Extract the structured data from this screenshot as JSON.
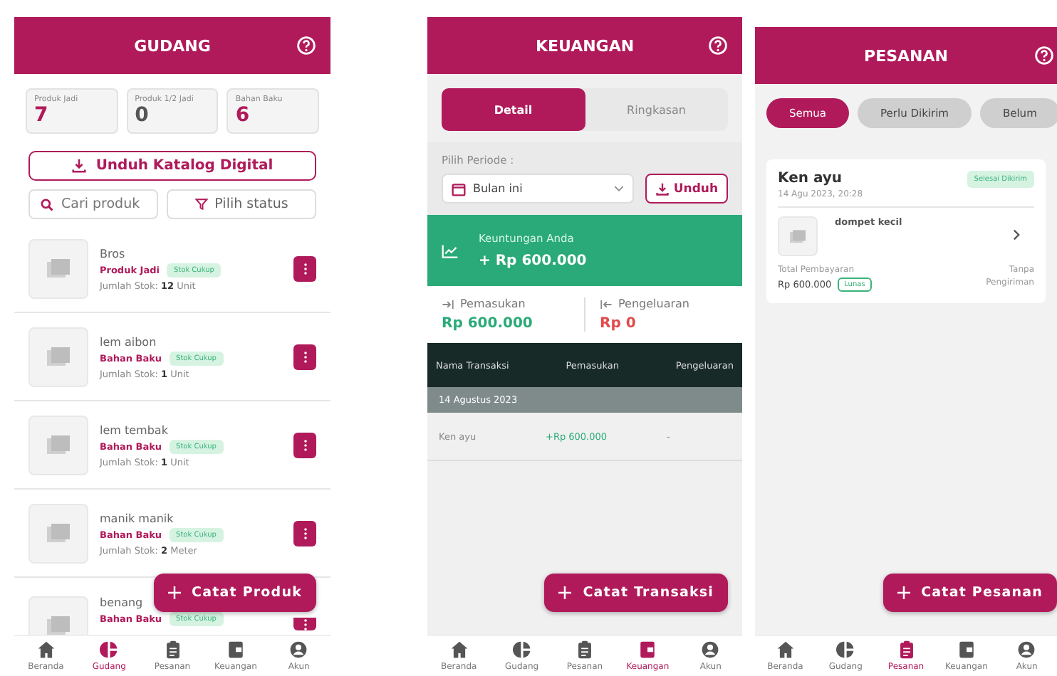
{
  "screens": [
    {
      "kind": "gudang",
      "title": "GUDANG",
      "stats": [
        {
          "label": "Produk Jadi",
          "value": "7",
          "color": "#b01a5a"
        },
        {
          "label": "Produk 1/2 Jadi",
          "value": "0",
          "color": "#555555"
        },
        {
          "label": "Bahan Baku",
          "value": "6",
          "color": "#b01a5a"
        }
      ],
      "catalog_button": "Unduh Katalog Digital",
      "search": {
        "placeholder": "Cari produk"
      },
      "filter_button": "Pilih status",
      "products": [
        {
          "name": "Bros",
          "category": "Produk Jadi",
          "badge": "Stok Cukup",
          "stock_label": "Jumlah Stok:",
          "qty": "12",
          "unit": "Unit"
        },
        {
          "name": "lem aibon",
          "category": "Bahan Baku",
          "badge": "Stok Cukup",
          "stock_label": "Jumlah Stok:",
          "qty": "1",
          "unit": "Unit"
        },
        {
          "name": "lem tembak",
          "category": "Bahan Baku",
          "badge": "Stok Cukup",
          "stock_label": "Jumlah Stok:",
          "qty": "1",
          "unit": "Unit"
        },
        {
          "name": "manik manik",
          "category": "Bahan Baku",
          "badge": "Stok Cukup",
          "stock_label": "Jumlah Stok:",
          "qty": "2",
          "unit": "Meter"
        },
        {
          "name": "benang",
          "category": "Bahan Baku",
          "badge": "Stok Cukup"
        }
      ],
      "fab": "Catat Produk",
      "nav": [
        {
          "label": "Beranda",
          "kind": "home",
          "selected": false
        },
        {
          "label": "Gudang",
          "kind": "pie",
          "selected": true
        },
        {
          "label": "Pesanan",
          "kind": "clipboard",
          "selected": false
        },
        {
          "label": "Keuangan",
          "kind": "wallet",
          "selected": false
        },
        {
          "label": "Akun",
          "kind": "user",
          "selected": false
        }
      ]
    },
    {
      "kind": "keuangan",
      "title": "KEUANGAN",
      "tabs": [
        {
          "label": "Detail",
          "selected": true
        },
        {
          "label": "Ringkasan",
          "selected": false
        }
      ],
      "period_label": "Pilih Periode :",
      "period_select": "Bulan ini",
      "download_button": "Unduh",
      "profit": {
        "label": "Keuntungan Anda",
        "value": "+ Rp 600.000"
      },
      "income": {
        "label": "Pemasukan",
        "value": "Rp 600.000"
      },
      "expense": {
        "label": "Pengeluaran",
        "value": "Rp 0"
      },
      "table": {
        "columns": [
          "Nama Transaksi",
          "Pemasukan",
          "Pengeluaran"
        ],
        "groups": [
          {
            "date": "14 Agustus 2023",
            "rows": [
              [
                "Ken ayu",
                "+Rp 600.000",
                "-"
              ]
            ]
          }
        ]
      },
      "fab": "Catat Transaksi",
      "nav": [
        {
          "label": "Beranda",
          "kind": "home",
          "selected": false
        },
        {
          "label": "Gudang",
          "kind": "pie",
          "selected": false
        },
        {
          "label": "Pesanan",
          "kind": "clipboard",
          "selected": false
        },
        {
          "label": "Keuangan",
          "kind": "wallet",
          "selected": true
        },
        {
          "label": "Akun",
          "kind": "user",
          "selected": false
        }
      ]
    },
    {
      "kind": "pesanan",
      "title": "PESANAN",
      "filters": [
        {
          "label": "Semua",
          "selected": true
        },
        {
          "label": "Perlu Dikirim",
          "selected": false
        },
        {
          "label": "Belum",
          "selected": false
        }
      ],
      "orders": [
        {
          "customer": "Ken ayu",
          "date": "14 Agu 2023, 20:28",
          "status": "Selesai Dikirim",
          "item": "dompet kecil",
          "total_label": "Total Pembayaran",
          "total": "Rp 600.000",
          "payment": "Lunas",
          "shipping": "Tanpa",
          "shipping_2": "Pengiriman"
        }
      ],
      "fab": "Catat Pesanan",
      "nav": [
        {
          "label": "Beranda",
          "kind": "home",
          "selected": false
        },
        {
          "label": "Gudang",
          "kind": "pie",
          "selected": false
        },
        {
          "label": "Pesanan",
          "kind": "clipboard",
          "selected": true
        },
        {
          "label": "Keuangan",
          "kind": "wallet",
          "selected": false
        },
        {
          "label": "Akun",
          "kind": "user",
          "selected": false
        }
      ]
    }
  ]
}
